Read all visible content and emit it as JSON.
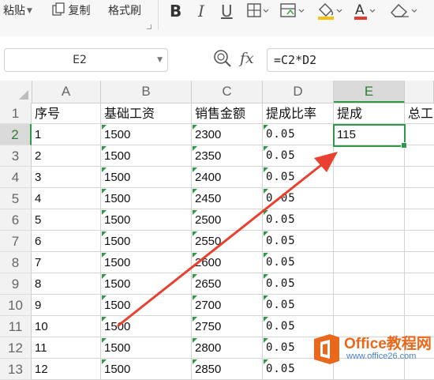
{
  "toolbar": {
    "paste_label": "粘贴",
    "copy_label": "复制",
    "format_painter_label": "格式刷",
    "bold_icon": "B",
    "italic_icon": "I",
    "underline_icon": "U"
  },
  "formula_bar": {
    "name_box": "E2",
    "fx_label": "fx",
    "formula": "=C2*D2"
  },
  "columns": [
    "A",
    "B",
    "C",
    "D",
    "E"
  ],
  "active_column": "E",
  "active_row": "2",
  "header_row": {
    "row_number": "1",
    "a": "序号",
    "b": "基础工资",
    "c": "销售金额",
    "d": "提成比率",
    "e": "提成",
    "f": "总工"
  },
  "rows": [
    {
      "n": "2",
      "a": "1",
      "b": "1500",
      "c": "2300",
      "d": "0.05",
      "e": "115"
    },
    {
      "n": "3",
      "a": "2",
      "b": "1500",
      "c": "2350",
      "d": "0.05",
      "e": ""
    },
    {
      "n": "4",
      "a": "3",
      "b": "1500",
      "c": "2400",
      "d": "0.05",
      "e": ""
    },
    {
      "n": "5",
      "a": "4",
      "b": "1500",
      "c": "2450",
      "d": "0.05",
      "e": ""
    },
    {
      "n": "6",
      "a": "5",
      "b": "1500",
      "c": "2500",
      "d": "0.05",
      "e": ""
    },
    {
      "n": "7",
      "a": "6",
      "b": "1500",
      "c": "2550",
      "d": "0.05",
      "e": ""
    },
    {
      "n": "8",
      "a": "7",
      "b": "1500",
      "c": "2600",
      "d": "0.05",
      "e": ""
    },
    {
      "n": "9",
      "a": "8",
      "b": "1500",
      "c": "2650",
      "d": "0.05",
      "e": ""
    },
    {
      "n": "10",
      "a": "9",
      "b": "1500",
      "c": "2700",
      "d": "0.05",
      "e": ""
    },
    {
      "n": "11",
      "a": "10",
      "b": "1500",
      "c": "2750",
      "d": "0.05",
      "e": ""
    },
    {
      "n": "12",
      "a": "11",
      "b": "1500",
      "c": "2800",
      "d": "0.05",
      "e": ""
    },
    {
      "n": "13",
      "a": "12",
      "b": "1500",
      "c": "2850",
      "d": "0.05",
      "e": ""
    }
  ],
  "watermark": {
    "line1": "Office教程网",
    "line2": "www.office26.com"
  },
  "colors": {
    "accent_green": "#2e9a47",
    "arrow_red": "#e8412f"
  }
}
